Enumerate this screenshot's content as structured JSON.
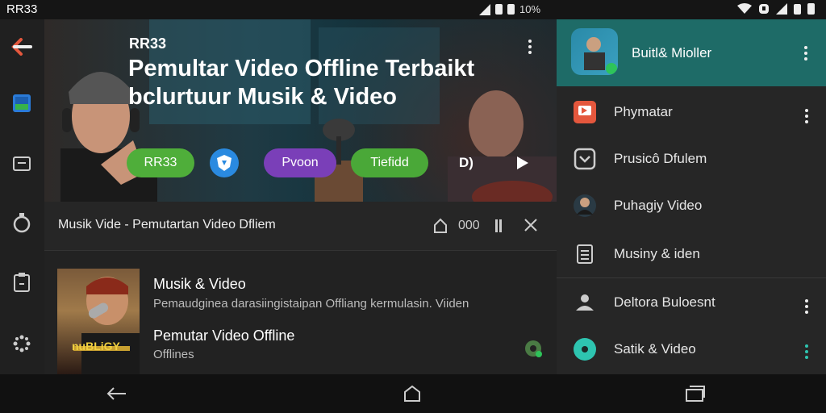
{
  "status_bar": {
    "time": "RR33",
    "battery_text": "10%"
  },
  "hero": {
    "brand": "RR33",
    "title_line1": "Pemultar Video Offline Terbaikt",
    "title_line2": "bclurtuur Musik & Video",
    "chips": [
      {
        "label": "RR33",
        "color": "#4fae3a"
      },
      {
        "label": "Pvoon",
        "color": "#7a3fb8"
      },
      {
        "label": "Tiefidd",
        "color": "#4aa838"
      }
    ],
    "audio_label": "D)"
  },
  "now_playing": {
    "title": "Musik Vide - Pemutartan Video Dfliem",
    "count": "000"
  },
  "list_item": {
    "title": "Musik & Video",
    "description": "Pemaudginea darasiingistaipan Offliang kermulasin. Viiden",
    "title2": "Pemutar Video Offline",
    "subtitle2": "Offlines",
    "thumb_text": "nuBLiGY"
  },
  "drawer": {
    "header_name": "Buitl& Mioller",
    "items": [
      {
        "label": "Phymatar",
        "icon": "play-square-icon"
      },
      {
        "label": "Prusicô Dfulem",
        "icon": "download-box-icon"
      },
      {
        "label": "Puhagiy Video",
        "icon": "profile-photo-icon"
      },
      {
        "label": "Musiny & iden",
        "icon": "document-icon"
      },
      {
        "label": "Deltora Buloesnt",
        "icon": "user-icon"
      },
      {
        "label": "Satik & Video",
        "icon": "teal-dot-icon"
      }
    ]
  },
  "colors": {
    "drawer_header": "#1e6b67",
    "accent_red": "#e4573d",
    "accent_teal": "#2ec4b0"
  }
}
